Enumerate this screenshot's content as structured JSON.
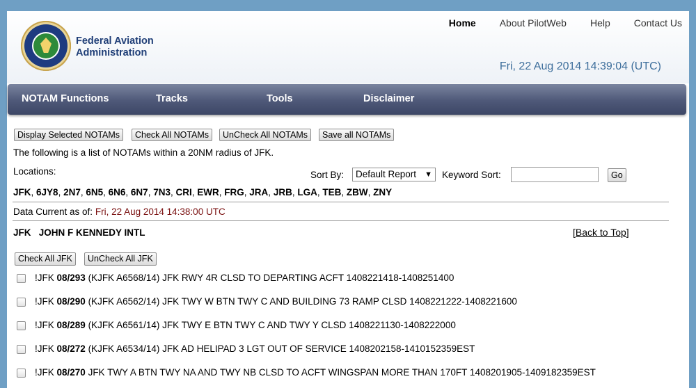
{
  "header": {
    "org_line1": "Federal Aviation",
    "org_line2": "Administration",
    "nav": [
      "Home",
      "About PilotWeb",
      "Help",
      "Contact Us"
    ],
    "datetime": "Fri, 22 Aug 2014 14:39:04 (UTC)"
  },
  "menu": [
    "NOTAM Functions",
    "Tracks",
    "Tools",
    "Disclaimer"
  ],
  "actions": {
    "display_selected": "Display Selected NOTAMs",
    "check_all": "Check All NOTAMs",
    "uncheck_all": "UnCheck All NOTAMs",
    "save_all": "Save all NOTAMs"
  },
  "intro": "The following is a list of NOTAMs within a 20NM radius of JFK.",
  "locations_label": "Locations:",
  "sort": {
    "label": "Sort By:",
    "selected": "Default Report",
    "keyword_label": "Keyword Sort:",
    "keyword_value": "",
    "go": "Go"
  },
  "locations": [
    "JFK",
    "6JY8",
    "2N7",
    "6N5",
    "6N6",
    "6N7",
    "7N3",
    "CRI",
    "EWR",
    "FRG",
    "JRA",
    "JRB",
    "LGA",
    "TEB",
    "ZBW",
    "ZNY"
  ],
  "data_current": {
    "label": "Data Current as of:",
    "value": "Fri, 22 Aug 2014 14:38:00 UTC"
  },
  "airport": {
    "code": "JFK",
    "name": "JOHN F KENNEDY INTL",
    "back_to_top": "Back to Top",
    "check_all": "Check All  JFK",
    "uncheck_all": "UnCheck All JFK"
  },
  "notams": [
    {
      "prefix": "!JFK ",
      "id": "08/293",
      "text": " (KJFK A6568/14) JFK RWY 4R CLSD TO DEPARTING ACFT 1408221418-1408251400"
    },
    {
      "prefix": "!JFK ",
      "id": "08/290",
      "text": " (KJFK A6562/14) JFK TWY W BTN TWY C AND BUILDING 73 RAMP CLSD 1408221222-1408221600"
    },
    {
      "prefix": "!JFK ",
      "id": "08/289",
      "text": " (KJFK A6561/14) JFK TWY E BTN TWY C AND TWY Y CLSD 1408221130-1408222000"
    },
    {
      "prefix": "!JFK ",
      "id": "08/272",
      "text": " (KJFK A6534/14) JFK AD HELIPAD 3 LGT OUT OF SERVICE 1408202158-1410152359EST"
    },
    {
      "prefix": "!JFK ",
      "id": "08/270",
      "text": " JFK TWY A BTN TWY NA AND TWY NB CLSD TO ACFT WINGSPAN MORE THAN 170FT 1408201905-1409182359EST"
    }
  ]
}
